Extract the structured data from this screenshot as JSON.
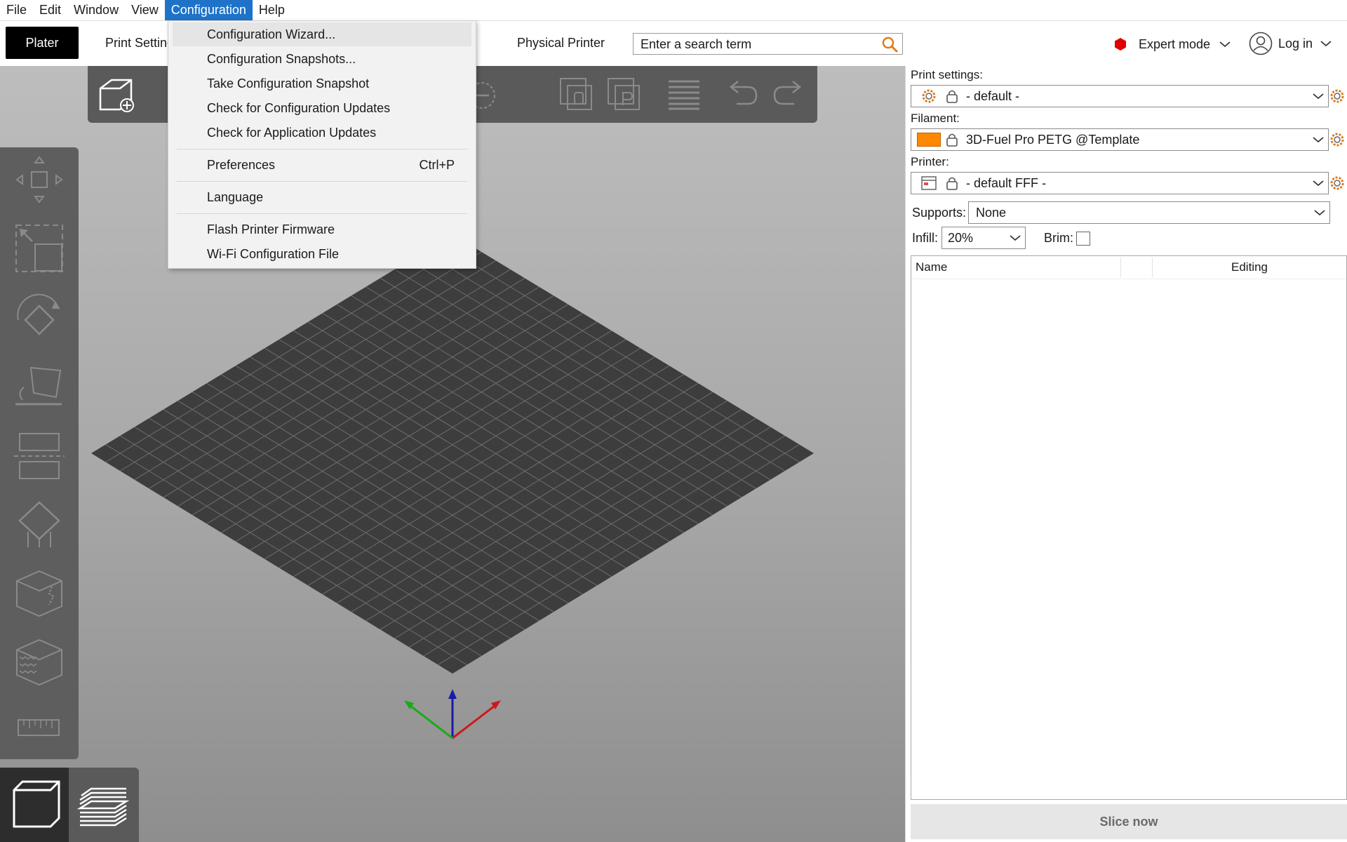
{
  "menubar": {
    "items": [
      "File",
      "Edit",
      "Window",
      "View",
      "Configuration",
      "Help"
    ]
  },
  "tabs": {
    "plater": "Plater",
    "print_settings": "Print Settings",
    "physical_printer": "Physical Printer"
  },
  "search": {
    "placeholder": "Enter a search term"
  },
  "mode": {
    "label": "Expert mode",
    "color": "#e00000"
  },
  "account": {
    "label": "Log in"
  },
  "config_menu": {
    "items": [
      {
        "label": "Configuration Wizard..."
      },
      {
        "label": "Configuration Snapshots..."
      },
      {
        "label": "Take Configuration Snapshot"
      },
      {
        "label": "Check for Configuration Updates"
      },
      {
        "label": "Check for Application Updates"
      },
      {
        "label": "Preferences",
        "shortcut": "Ctrl+P"
      },
      {
        "label": "Language"
      },
      {
        "label": "Flash Printer Firmware"
      },
      {
        "label": "Wi-Fi Configuration File"
      }
    ]
  },
  "sidebar": {
    "print_settings_label": "Print settings:",
    "print_settings_value": "- default -",
    "filament_label": "Filament:",
    "filament_value": "3D-Fuel Pro PETG @Template",
    "filament_color": "#ff8800",
    "printer_label": "Printer:",
    "printer_value": "- default FFF -",
    "supports_label": "Supports:",
    "supports_value": "None",
    "infill_label": "Infill:",
    "infill_value": "20%",
    "brim_label": "Brim:",
    "list_col_name": "Name",
    "list_col_editing": "Editing",
    "slice_button": "Slice now"
  },
  "colors": {
    "accent": "#1e73c9",
    "bed": "#3d3d3d",
    "gear_orange": "#e07b1a"
  }
}
